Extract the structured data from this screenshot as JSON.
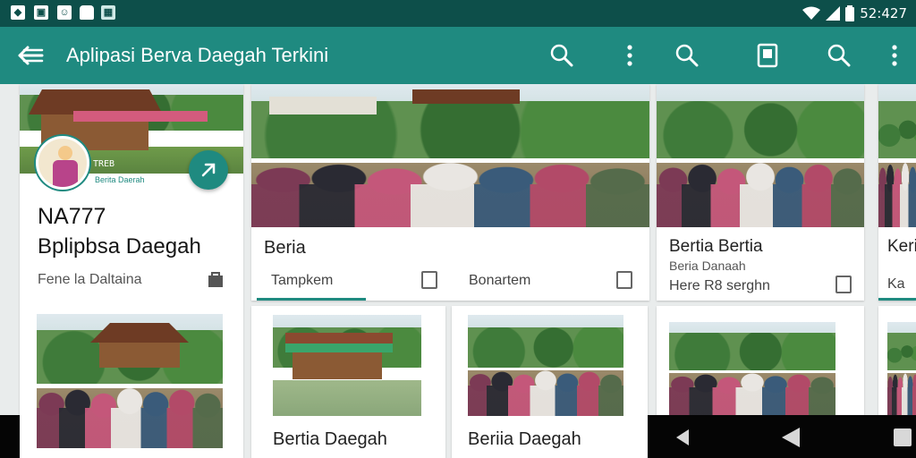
{
  "status_bar": {
    "time": "52:427",
    "icons": [
      "notification-a-icon",
      "notification-b-icon",
      "notification-c-icon",
      "notification-d-icon",
      "notification-e-icon",
      "wifi-icon",
      "signal-icon",
      "battery-icon"
    ]
  },
  "app_bar": {
    "title": "Aplipasi Berva Daegah Terkini",
    "actions": [
      "search-icon",
      "more-vert-icon",
      "search-icon",
      "bookmark-icon",
      "search-icon",
      "more-vert-icon"
    ]
  },
  "colors": {
    "primary": "#1f8a80",
    "status_bar": "#0d4f4a",
    "nav_bar": "#050505"
  },
  "profile_card": {
    "banner_caption": "TREB",
    "badge_text": "Berita Daerah",
    "code": "NA777",
    "name": "Bplipbsa Daegah",
    "subtitle": "Fene la Daltaina"
  },
  "feature_card": {
    "title": "Beria",
    "tabs": [
      "Tampkem",
      "Bonartem"
    ]
  },
  "side_card": {
    "title": "Bertia Bertia",
    "subtitle": "Beria Danaah",
    "meta": "Here R8 serghn"
  },
  "edge_card": {
    "title": "Keri",
    "subtitle": "Ka"
  },
  "grid_cards": [
    {
      "title": "Bertia Daegah"
    },
    {
      "title": "Beriia Daegah"
    }
  ],
  "nav_bar": {
    "buttons": [
      "back-icon",
      "home-icon",
      "recents-icon"
    ]
  }
}
